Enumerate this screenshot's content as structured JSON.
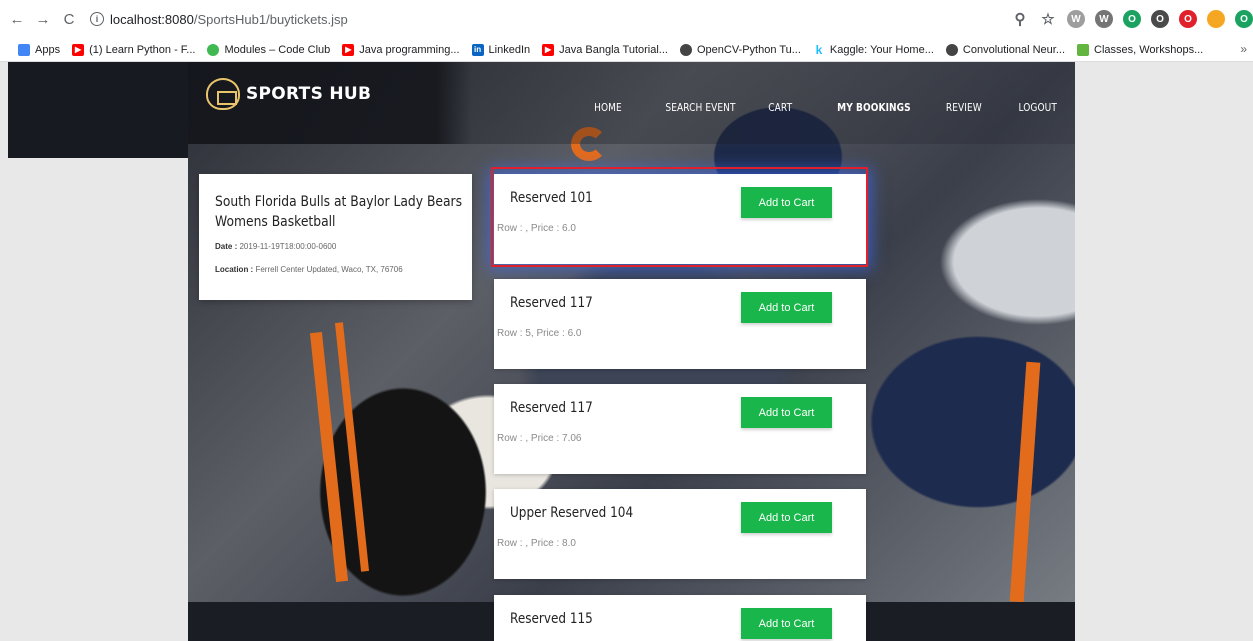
{
  "browser": {
    "nav": {
      "back": "←",
      "forward": "→",
      "reload": "C"
    },
    "url": {
      "host": "localhost:8080",
      "path": "/SportsHub1/buytickets.jsp"
    },
    "extensions": [
      "⚲",
      "☆",
      "W",
      "W",
      "O",
      "O",
      "O",
      "O"
    ],
    "bookmarks": [
      {
        "label": "Apps",
        "color": "#5f6368"
      },
      {
        "label": "(1) Learn Python - F...",
        "color": "#ff0000"
      },
      {
        "label": "Modules – Code Club",
        "color": "#3fb950"
      },
      {
        "label": "Java programming...",
        "color": "#ff0000"
      },
      {
        "label": "LinkedIn",
        "color": "#0a66c2"
      },
      {
        "label": "Java Bangla Tutorial...",
        "color": "#ff0000"
      },
      {
        "label": "OpenCV-Python Tu...",
        "color": "#444444"
      },
      {
        "label": "Kaggle: Your Home...",
        "color": "#20beff"
      },
      {
        "label": "Convolutional Neur...",
        "color": "#444444"
      },
      {
        "label": "Classes, Workshops...",
        "color": "#62b53f"
      }
    ],
    "bookmarks_more": "»"
  },
  "site": {
    "logo": "SPORTS HUB",
    "nav": [
      "HOME",
      "SEARCH EVENT",
      "CART",
      "MY BOOKINGS",
      "REVIEW",
      "LOGOUT"
    ]
  },
  "event": {
    "title": "South Florida Bulls at Baylor Lady Bears Womens Basketball",
    "date_label": "Date :",
    "date": "2019-11-19T18:00:00-0600",
    "location_label": "Location :",
    "location": "Ferrell Center Updated, Waco, TX, 76706"
  },
  "tickets": [
    {
      "name": "Reserved 101",
      "info": "Row : , Price : 6.0",
      "button": "Add to Cart"
    },
    {
      "name": "Reserved 117",
      "info": "Row : 5, Price : 6.0",
      "button": "Add to Cart"
    },
    {
      "name": "Reserved 117",
      "info": "Row : , Price : 7.06",
      "button": "Add to Cart"
    },
    {
      "name": "Upper Reserved 104",
      "info": "Row : , Price : 8.0",
      "button": "Add to Cart"
    },
    {
      "name": "Reserved 115",
      "info": "",
      "button": "Add to Cart"
    }
  ],
  "colors": {
    "button": "#19b64b",
    "highlight": "#e0202a",
    "header": "#181a21"
  }
}
